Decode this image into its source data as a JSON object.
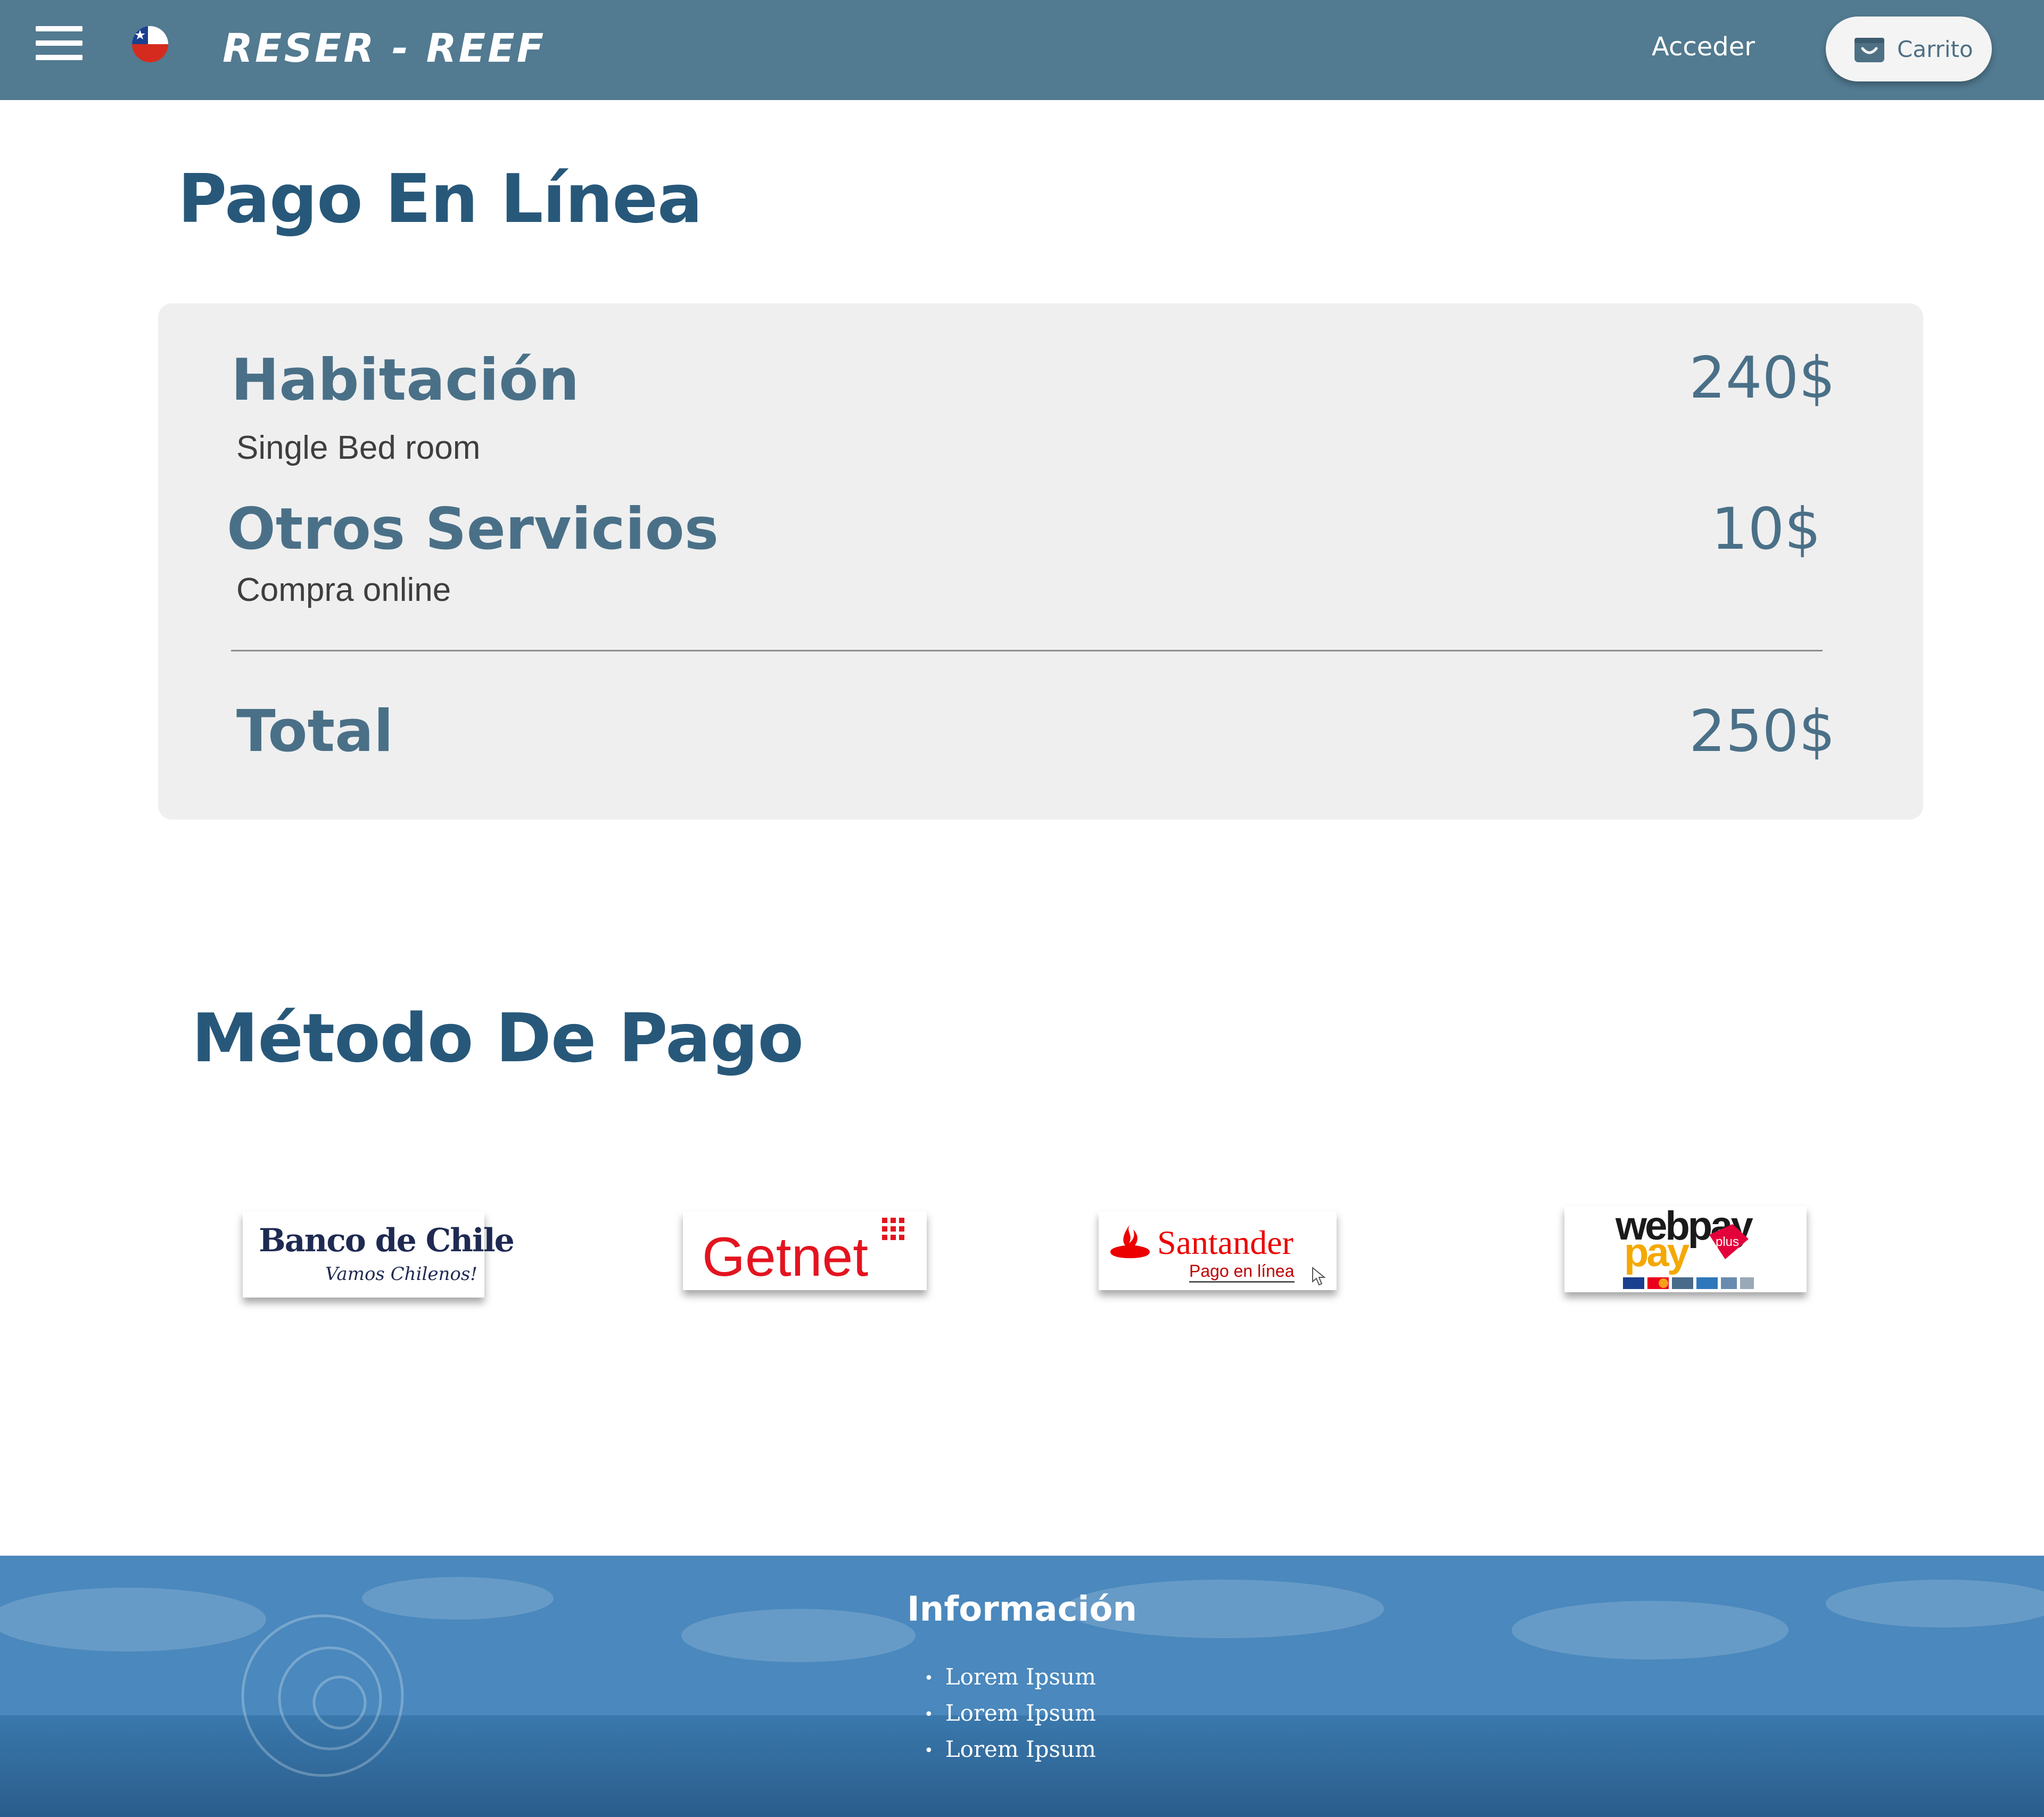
{
  "header": {
    "brand": "RESER - REEF",
    "login_label": "Acceder",
    "cart_label": "Carrito",
    "background": "#527a90"
  },
  "payment": {
    "title": "Pago En Línea",
    "items": [
      {
        "title": "Habitación",
        "subtitle": "Single Bed room",
        "price": "240$"
      },
      {
        "title": "Otros Servicios",
        "subtitle": "Compra online",
        "price": "10$"
      }
    ],
    "total_label": "Total",
    "total_value": "250$"
  },
  "methods": {
    "title": "Método De Pago",
    "options": [
      {
        "name": "Banco de Chile",
        "tagline": "Vamos Chilenos!"
      },
      {
        "name": "Getnet"
      },
      {
        "name": "Santander",
        "tagline": "Pago en línea"
      },
      {
        "name": "webpay",
        "name2": "pay",
        "badge": "plus"
      }
    ]
  },
  "footer": {
    "title": "Información",
    "links": [
      "Lorem Ipsum",
      "Lorem Ipsum",
      "Lorem Ipsum"
    ]
  },
  "colors": {
    "heading": "#27587a",
    "accent": "#4a7088",
    "footer": "#3b78ad",
    "getnet_red": "#e3141f",
    "santander_red": "#ec0000"
  }
}
